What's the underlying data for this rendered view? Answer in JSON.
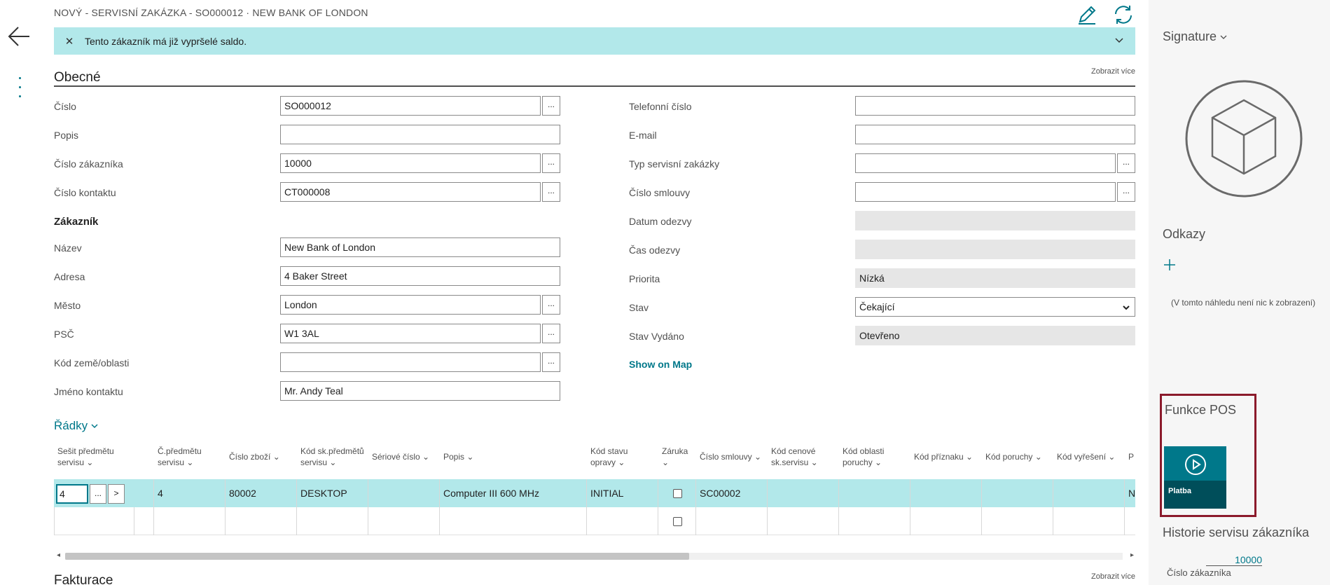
{
  "header": {
    "title": "NOVÝ - SERVISNÍ ZAKÁZKA - SO000012 · NEW BANK OF LONDON",
    "icons": [
      "back-arrow-icon",
      "more-vertical-icon",
      "pencil-icon",
      "refresh-icon"
    ]
  },
  "notice": {
    "text": "Tento zákazník má již vypršelé saldo."
  },
  "general": {
    "section_label": "Obecné",
    "show_more": "Zobrazit více",
    "left_fields": [
      {
        "label": "Číslo",
        "value": "SO000012"
      },
      {
        "label": "Popis",
        "value": ""
      },
      {
        "label": "Číslo zákazníka",
        "value": "10000"
      },
      {
        "label": "Číslo kontaktu",
        "value": "CT000008"
      }
    ],
    "customer_subhead": "Zákazník",
    "customer_fields": [
      {
        "label": "Název",
        "value": "New Bank of London"
      },
      {
        "label": "Adresa",
        "value": "4 Baker Street"
      },
      {
        "label": "Město",
        "value": "London"
      },
      {
        "label": "PSČ",
        "value": "W1 3AL"
      },
      {
        "label": "Kód země/oblasti",
        "value": ""
      },
      {
        "label": "Jméno kontaktu",
        "value": "Mr. Andy Teal"
      }
    ],
    "right_fields": [
      {
        "label": "Telefonní číslo",
        "value": ""
      },
      {
        "label": "E-mail",
        "value": ""
      },
      {
        "label": "Typ servisní zakázky",
        "value": ""
      },
      {
        "label": "Číslo smlouvy",
        "value": ""
      },
      {
        "label": "Datum odezvy",
        "value": ""
      },
      {
        "label": "Čas odezvy",
        "value": ""
      },
      {
        "label": "Priorita",
        "value": "Nízká"
      },
      {
        "label": "Stav",
        "value": "Čekající"
      },
      {
        "label": "Stav Vydáno",
        "value": "Otevřeno"
      }
    ],
    "map_link": "Show on Map",
    "lookup_label": "...",
    "next_label": ">"
  },
  "lines": {
    "title": "Řádky",
    "columns": [
      [
        "Sešit předmětu",
        "servisu"
      ],
      [
        "Č.předmětu",
        "servisu"
      ],
      [
        "Číslo zboží",
        ""
      ],
      [
        "Kód sk.předmětů",
        "servisu"
      ],
      [
        "Sériové číslo",
        ""
      ],
      [
        "Popis",
        ""
      ],
      [
        "Kód stavu",
        "opravy"
      ],
      [
        "Záruka",
        ""
      ],
      [
        "Číslo smlouvy",
        ""
      ],
      [
        "Kód cenové",
        "sk.servisu"
      ],
      [
        "Kód oblasti",
        "poruchy"
      ],
      [
        "Kód příznaku",
        ""
      ],
      [
        "Kód poruchy",
        ""
      ],
      [
        "Kód vyřešení",
        ""
      ],
      [
        "P",
        ""
      ]
    ],
    "row1": {
      "worksheet": "4",
      "item_no": "4",
      "goods_no": "80002",
      "group_code": "DESKTOP",
      "serial": "",
      "description": "Computer III 600 MHz",
      "repair_status": "INITIAL",
      "contract_no": "SC00002",
      "last": "N"
    }
  },
  "scroll": {
    "fraction_visible": 0.59
  },
  "bottom": {
    "section_label": "Fakturace",
    "show_more": "Zobrazit více"
  },
  "factbox": {
    "signature_title": "Signature",
    "links_title": "Odkazy",
    "links_empty": "(V tomto náhledu není nic k zobrazení)",
    "pos_title": "Funkce POS",
    "pos_tile_label": "Platba",
    "history_title": "Historie servisu zákazníka",
    "history_value": "10000",
    "history_value_label": "Číslo zákazníka"
  },
  "colors": {
    "accent": "#00788a",
    "notice_bg": "#b2e8ea",
    "highlight_border": "#8b1a2b"
  }
}
